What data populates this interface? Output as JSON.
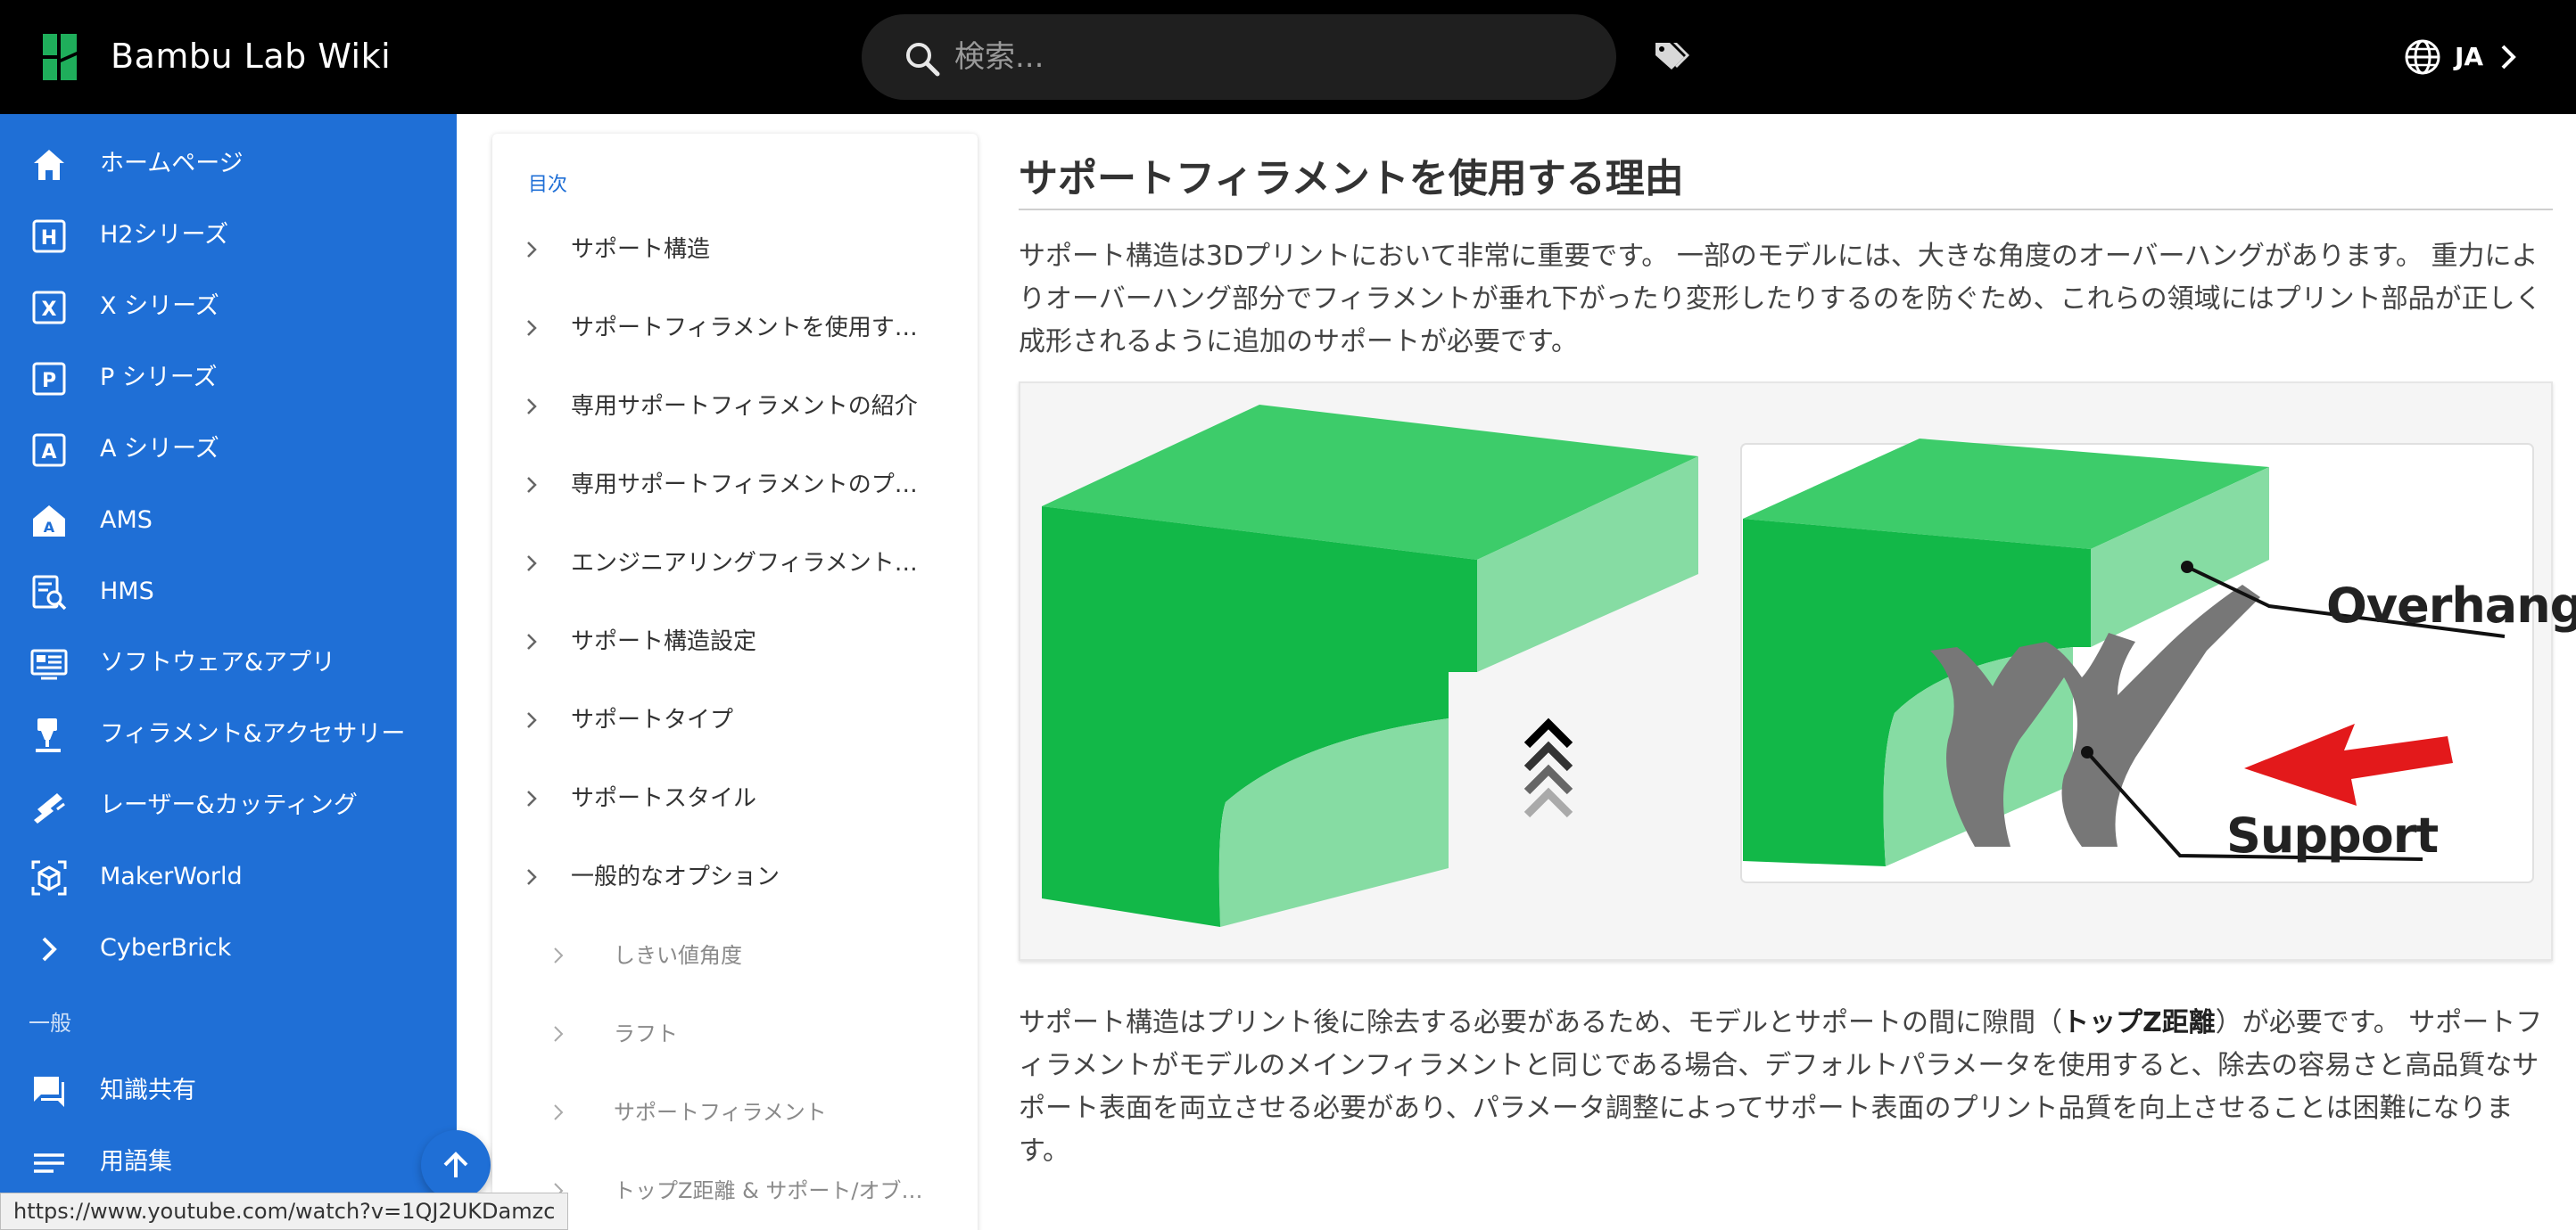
{
  "header": {
    "site_title": "Bambu Lab Wiki",
    "search_placeholder": "検索...",
    "language": "JA",
    "icons": [
      "bambu-logo-icon",
      "search-icon",
      "tag-icon",
      "globe-icon",
      "chevron-right-icon"
    ]
  },
  "sidebar": {
    "items": [
      {
        "label": "ホームページ",
        "icon": "home-icon"
      },
      {
        "label": "H2シリーズ",
        "icon": "letter-h-icon"
      },
      {
        "label": "X シリーズ",
        "icon": "letter-x-icon"
      },
      {
        "label": "P シリーズ",
        "icon": "letter-p-icon"
      },
      {
        "label": "A シリーズ",
        "icon": "letter-a-icon"
      },
      {
        "label": "AMS",
        "icon": "ams-house-icon"
      },
      {
        "label": "HMS",
        "icon": "hms-search-icon"
      },
      {
        "label": "ソフトウェア&アプリ",
        "icon": "software-icon"
      },
      {
        "label": "フィラメント&アクセサリー",
        "icon": "filament-icon"
      },
      {
        "label": "レーザー&カッティング",
        "icon": "laser-icon"
      },
      {
        "label": "MakerWorld",
        "icon": "makerworld-icon"
      },
      {
        "label": "CyberBrick",
        "icon": "chevron-right-icon"
      }
    ],
    "section_label": "一般",
    "general_items": [
      {
        "label": "知識共有",
        "icon": "chat-icon"
      },
      {
        "label": "用語集",
        "icon": "list-icon"
      }
    ],
    "accent_color": "#1f6fd6"
  },
  "toc": {
    "title": "目次",
    "items": [
      {
        "label": "サポート構造",
        "level": 1
      },
      {
        "label": "サポートフィラメントを使用す…",
        "level": 1
      },
      {
        "label": "専用サポートフィラメントの紹介",
        "level": 1
      },
      {
        "label": "専用サポートフィラメントのプ…",
        "level": 1
      },
      {
        "label": "エンジニアリングフィラメント…",
        "level": 1
      },
      {
        "label": "サポート構造設定",
        "level": 1
      },
      {
        "label": "サポートタイプ",
        "level": 1
      },
      {
        "label": "サポートスタイル",
        "level": 1
      },
      {
        "label": "一般的なオプション",
        "level": 1
      },
      {
        "label": "しきい値角度",
        "level": 2
      },
      {
        "label": "ラフト",
        "level": 2
      },
      {
        "label": "サポートフィラメント",
        "level": 2
      },
      {
        "label": "トップZ距離 & サポート/オブ…",
        "level": 2
      }
    ]
  },
  "article": {
    "heading": "サポートフィラメントを使用する理由",
    "paragraph1": "サポート構造は3Dプリントにおいて非常に重要です。 一部のモデルには、大きな角度のオーバーハングがあります。 重力によりオーバーハング部分でフィラメントが垂れ下がったり変形したりするのを防ぐため、これらの領域にはプリント部品が正しく成形されるように追加のサポートが必要です。",
    "figure_labels": {
      "overhang": "Overhang",
      "support": "Support"
    },
    "paragraph2_before": "サポート構造はプリント後に除去する必要があるため、モデルとサポートの間に隙間（",
    "paragraph2_bold": "トップZ距離",
    "paragraph2_after": "）が必要です。 サポートフィラメントがモデルのメインフィラメントと同じである場合、デフォルトパラメータを使用すると、除去の容易さと高品質なサポート表面を両立させる必要があり、パラメータ調整によってサポート表面のプリント品質を向上させることは困難になります。"
  },
  "status_bar": {
    "url": "https://www.youtube.com/watch?v=1QJ2UKDamzc"
  }
}
